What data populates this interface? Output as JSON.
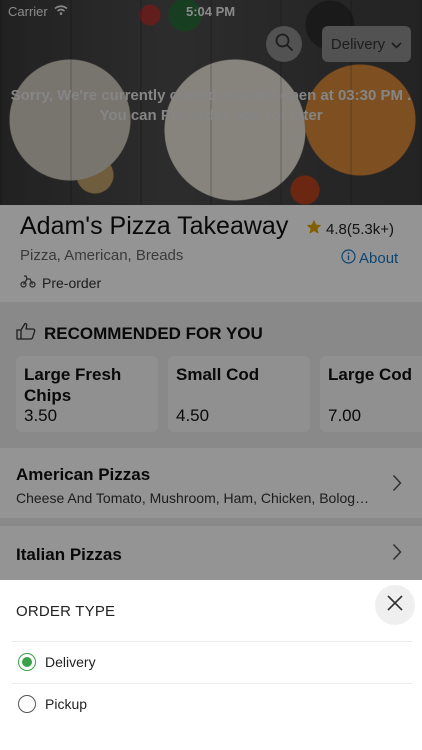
{
  "status_bar": {
    "carrier": "Carrier",
    "time": "5:04 PM"
  },
  "header": {
    "order_type_selected": "Delivery",
    "closed_message_line1": "Sorry, We're currently closed and will open at 03:30 PM .",
    "closed_message_line2": "You can Pre-order now for later"
  },
  "restaurant": {
    "name": "Adam's Pizza Takeaway",
    "rating": "4.8(5.3k+)",
    "cuisines": "Pizza, American, Breads",
    "about_label": "About",
    "preorder_label": "Pre-order"
  },
  "recommended": {
    "heading": "RECOMMENDED FOR YOU",
    "items": [
      {
        "name": "Large Fresh Chips",
        "price": "3.50"
      },
      {
        "name": "Small Cod",
        "price": "4.50"
      },
      {
        "name": "Large Cod",
        "price": "7.00"
      }
    ]
  },
  "categories": [
    {
      "name": "American Pizzas",
      "description": "Cheese And Tomato, Mushroom, Ham, Chicken, Bolog…"
    },
    {
      "name": "Italian Pizzas",
      "description": ""
    }
  ],
  "order_sheet": {
    "title": "ORDER TYPE",
    "options": [
      {
        "label": "Delivery",
        "selected": true
      },
      {
        "label": "Pickup",
        "selected": false
      }
    ]
  },
  "colors": {
    "accent_green": "#3aa14a",
    "link_blue": "#1a78c2",
    "star": "#e0a400"
  }
}
